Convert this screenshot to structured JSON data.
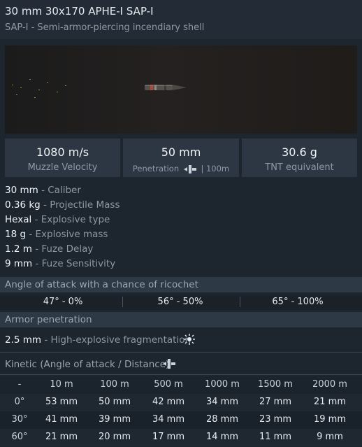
{
  "header": {
    "title": "30 mm 30x170 APHE-I SAP-I",
    "subtitle": "SAP-I - Semi-armor-piercing incendiary shell"
  },
  "stats": {
    "velocity": {
      "value": "1080 m/s",
      "label": "Muzzle Velocity"
    },
    "penetration": {
      "value": "50 mm",
      "label_prefix": "Penetration",
      "label_suffix": "| 100m",
      "icon": "penetration-icon"
    },
    "tnt": {
      "value": "30.6 g",
      "label": "TNT equivalent"
    }
  },
  "properties": [
    {
      "value": "30 mm",
      "name": "- Caliber"
    },
    {
      "value": "0.36 kg",
      "name": "- Projectile Mass"
    },
    {
      "value": "Hexal",
      "name": "- Explosive type"
    },
    {
      "value": "18 g",
      "name": "- Explosive mass"
    },
    {
      "value": "1.2 m",
      "name": "- Fuze Delay"
    },
    {
      "value": "9 mm",
      "name": "- Fuze Sensitivity"
    }
  ],
  "ricochet": {
    "title": "Angle of attack with a chance of ricochet",
    "cells": [
      "47° - 0%",
      "56° - 50%",
      "65° - 100%"
    ]
  },
  "armor": {
    "title": "Armor penetration",
    "he_value": "2.5 mm",
    "he_name": "- High-explosive fragmentation",
    "he_icon": "explosion-icon"
  },
  "kinetic": {
    "title": "Kinetic (Angle of attack / Distance)",
    "icon": "penetration-icon",
    "corner": "-",
    "distances": [
      "10 m",
      "100 m",
      "500 m",
      "1000 m",
      "1500 m",
      "2000 m"
    ],
    "rows": [
      {
        "angle": "0°",
        "values": [
          "53 mm",
          "50 mm",
          "42 mm",
          "34 mm",
          "27 mm",
          "21 mm"
        ]
      },
      {
        "angle": "30°",
        "values": [
          "41 mm",
          "39 mm",
          "34 mm",
          "28 mm",
          "23 mm",
          "19 mm"
        ]
      },
      {
        "angle": "60°",
        "values": [
          "21 mm",
          "20 mm",
          "17 mm",
          "14 mm",
          "11 mm",
          "9 mm"
        ]
      }
    ]
  }
}
